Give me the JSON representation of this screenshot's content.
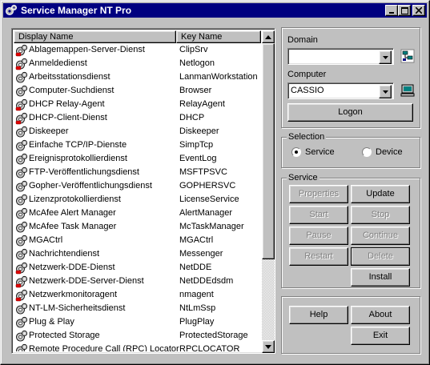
{
  "window": {
    "title": "Service Manager NT Pro"
  },
  "list": {
    "columns": [
      "Display Name",
      "Key Name"
    ],
    "rows": [
      {
        "display": "Ablagemappen-Server-Dienst",
        "key": "ClipSrv",
        "status": "stopped"
      },
      {
        "display": "Anmeldedienst",
        "key": "Netlogon",
        "status": "stopped"
      },
      {
        "display": "Arbeitsstationsdienst",
        "key": "LanmanWorkstation",
        "status": "running"
      },
      {
        "display": "Computer-Suchdienst",
        "key": "Browser",
        "status": "running"
      },
      {
        "display": "DHCP Relay-Agent",
        "key": "RelayAgent",
        "status": "stopped"
      },
      {
        "display": "DHCP-Client-Dienst",
        "key": "DHCP",
        "status": "stopped"
      },
      {
        "display": "Diskeeper",
        "key": "Diskeeper",
        "status": "running"
      },
      {
        "display": "Einfache TCP/IP-Dienste",
        "key": "SimpTcp",
        "status": "running"
      },
      {
        "display": "Ereignisprotokollierdienst",
        "key": "EventLog",
        "status": "running"
      },
      {
        "display": "FTP-Veröffentlichungsdienst",
        "key": "MSFTPSVC",
        "status": "running"
      },
      {
        "display": "Gopher-Veröffentlichungsdienst",
        "key": "GOPHERSVC",
        "status": "running"
      },
      {
        "display": "Lizenzprotokollierdienst",
        "key": "LicenseService",
        "status": "running"
      },
      {
        "display": "McAfee Alert Manager",
        "key": "AlertManager",
        "status": "running"
      },
      {
        "display": "McAfee Task Manager",
        "key": "McTaskManager",
        "status": "running"
      },
      {
        "display": "MGACtrl",
        "key": "MGACtrl",
        "status": "running"
      },
      {
        "display": "Nachrichtendienst",
        "key": "Messenger",
        "status": "running"
      },
      {
        "display": "Netzwerk-DDE-Dienst",
        "key": "NetDDE",
        "status": "stopped"
      },
      {
        "display": "Netzwerk-DDE-Server-Dienst",
        "key": "NetDDEdsdm",
        "status": "stopped"
      },
      {
        "display": "Netzwerkmonitoragent",
        "key": "nmagent",
        "status": "stopped"
      },
      {
        "display": "NT-LM-Sicherheitsdienst",
        "key": "NtLmSsp",
        "status": "running"
      },
      {
        "display": "Plug & Play",
        "key": "PlugPlay",
        "status": "running"
      },
      {
        "display": "Protected Storage",
        "key": "ProtectedStorage",
        "status": "running"
      },
      {
        "display": "Remote Procedure Call (RPC) Locator",
        "key": "RPCLOCATOR",
        "status": "stopped"
      }
    ]
  },
  "domain": {
    "label": "Domain",
    "value": ""
  },
  "computer": {
    "label": "Computer",
    "value": "CASSIO"
  },
  "logon_label": "Logon",
  "selection": {
    "title": "Selection",
    "options": [
      "Service",
      "Device"
    ],
    "selected": "Service"
  },
  "service": {
    "title": "Service",
    "properties": "Properties",
    "update": "Update",
    "start": "Start",
    "stop": "Stop",
    "pause": "Pause",
    "continue": "Continue",
    "restart": "Restart",
    "delete": "Delete",
    "install": "Install"
  },
  "bottom": {
    "help": "Help",
    "about": "About",
    "exit": "Exit"
  },
  "colors": {
    "titlebar": "#000080",
    "face": "#c0c0c0",
    "disabled_text": "#808080"
  }
}
